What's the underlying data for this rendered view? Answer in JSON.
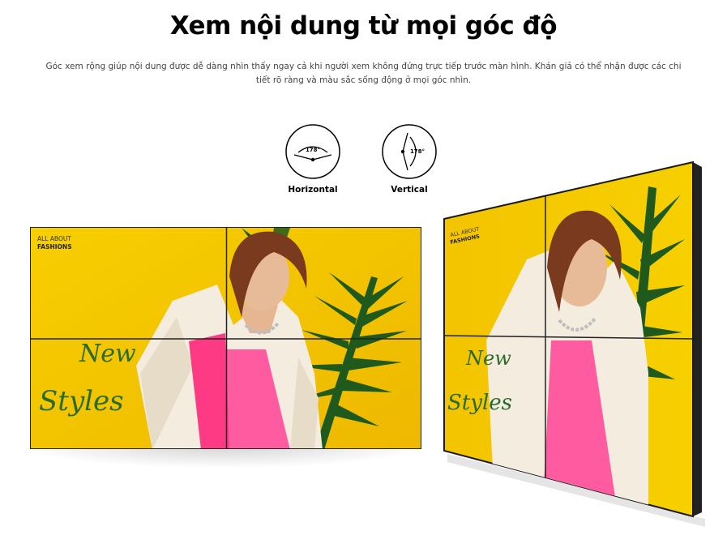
{
  "heading": "Xem nội dung từ mọi góc độ",
  "description": "Góc xem rộng giúp nội dung được dễ dàng nhìn thấy ngay cả khi người xem không đứng trực tiếp trước màn hình. Khán giả có thể nhận được các chi tiết rõ ràng và màu sắc sống động ở mọi góc nhìn.",
  "viewing_angles": [
    {
      "label": "Horizontal",
      "degrees": "178°",
      "icon": "horizontal-view-angle-icon"
    },
    {
      "label": "Vertical",
      "degrees": "178°",
      "icon": "vertical-view-angle-icon"
    }
  ],
  "video_wall": {
    "overlay_small_line1": "ALL ABOUT",
    "overlay_small_line2": "FASHIONS",
    "script_line1": "New",
    "script_line2": "Styles",
    "grid": "2x2",
    "colors": {
      "background_yellow": "#f3c400",
      "top_pink": "#ff5ba0",
      "leaf_green": "#1f5a1c",
      "bezel": "#1a1a1a"
    }
  }
}
